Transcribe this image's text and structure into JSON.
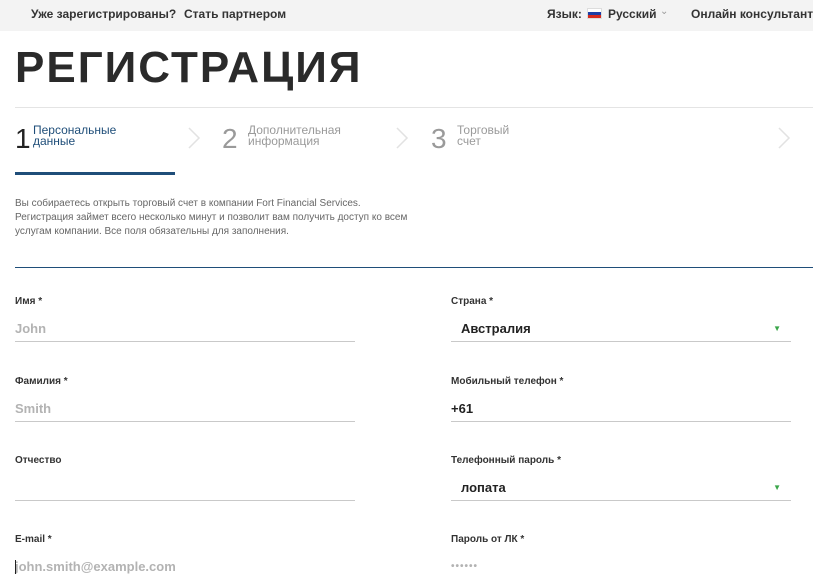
{
  "topbar": {
    "already_registered": "Уже зарегистрированы?",
    "become_partner": "Стать партнером",
    "language_label": "Язык:",
    "language_value": "Русский",
    "online_consultant": "Онлайн консультант",
    "flag_colors": [
      "#ffffff",
      "#1c3fa6",
      "#d52b1e"
    ]
  },
  "page_title": "РЕГИСТРАЦИЯ",
  "steps": [
    {
      "number": "1",
      "line1": "Персональные",
      "line2": "данные",
      "active": true
    },
    {
      "number": "2",
      "line1": "Дополнительная",
      "line2": "информация",
      "active": false
    },
    {
      "number": "3",
      "line1": "Торговый",
      "line2": "счет",
      "active": false
    }
  ],
  "intro": {
    "line1": "Вы собираетесь открыть торговый счет в компании Fort Financial Services.",
    "line2": "Регистрация займет всего несколько минут и позволит вам получить доступ ко всем",
    "line3": "услугам компании. Все поля обязательны для заполнения."
  },
  "form": {
    "first_name": {
      "label": "Имя *",
      "placeholder": "John"
    },
    "last_name": {
      "label": "Фамилия *",
      "placeholder": "Smith"
    },
    "middle_name": {
      "label": "Отчество",
      "placeholder": ""
    },
    "email": {
      "label": "E-mail *",
      "placeholder": "john.smith@example.com"
    },
    "country": {
      "label": "Страна *",
      "value": "Австралия"
    },
    "mobile": {
      "label": "Мобильный телефон *",
      "value": "+61"
    },
    "phone_password": {
      "label": "Телефонный пароль *",
      "value": "лопата"
    },
    "account_password": {
      "label": "Пароль от ЛК *",
      "placeholder": "••••••"
    }
  },
  "colors": {
    "accent": "#1f4e79",
    "select_caret": "#3aa64a",
    "topbar_bg": "#f3f3f3"
  }
}
